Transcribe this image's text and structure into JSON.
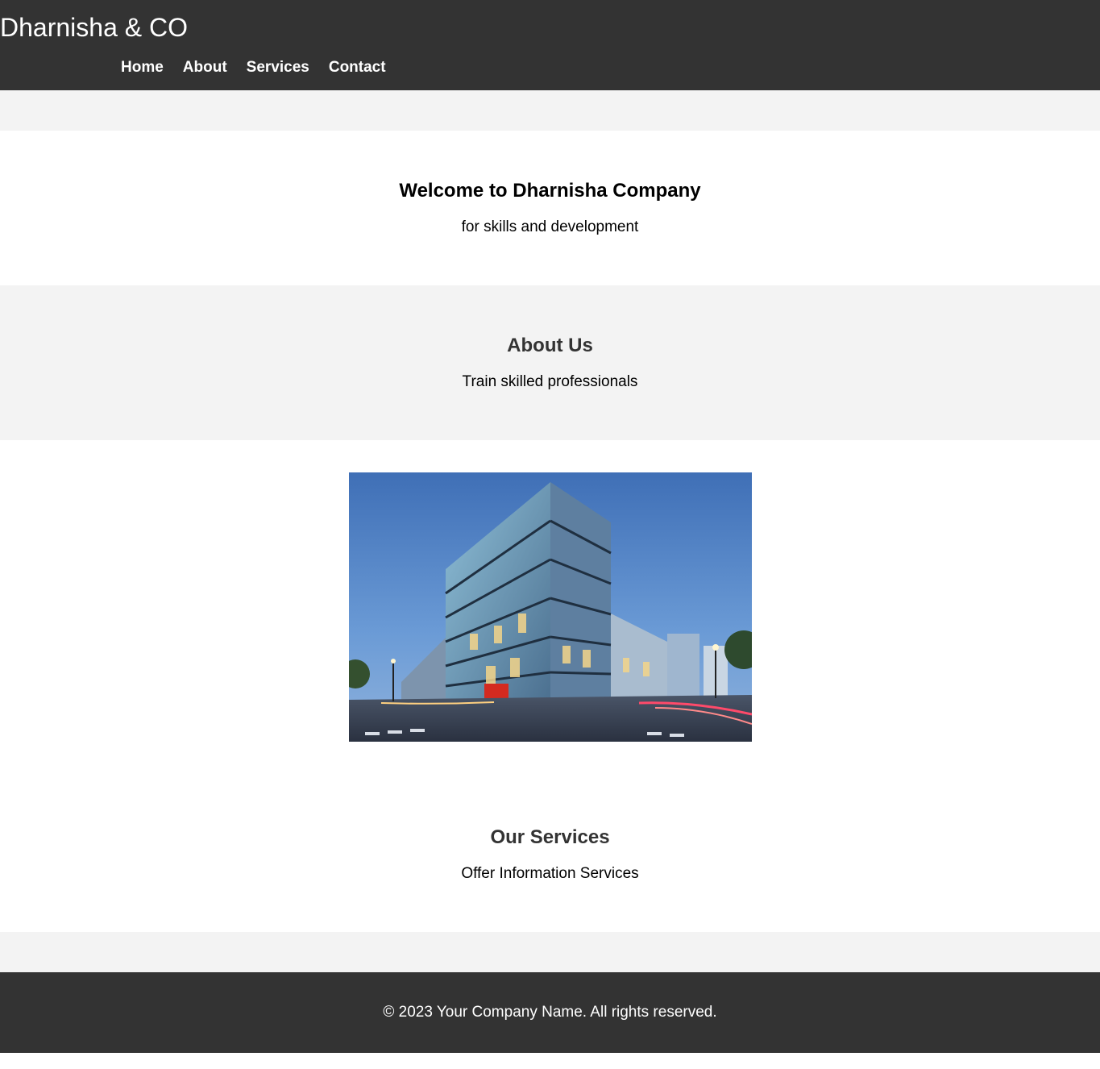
{
  "header": {
    "logo": "Dharnisha & CO",
    "nav": [
      "Home",
      "About",
      "Services",
      "Contact"
    ]
  },
  "hero": {
    "title": "Welcome to Dharnisha Company",
    "subtitle": "for skills and development"
  },
  "about": {
    "title": "About Us",
    "text": "Train skilled professionals"
  },
  "image": {
    "alt": "Office building at dusk"
  },
  "services": {
    "title": "Our Services",
    "text": "Offer Information Services"
  },
  "footer": {
    "text": "© 2023 Your Company Name. All rights reserved."
  },
  "colors": {
    "header_bg": "#333333",
    "band_bg": "#f3f3f3",
    "text": "#000000"
  }
}
